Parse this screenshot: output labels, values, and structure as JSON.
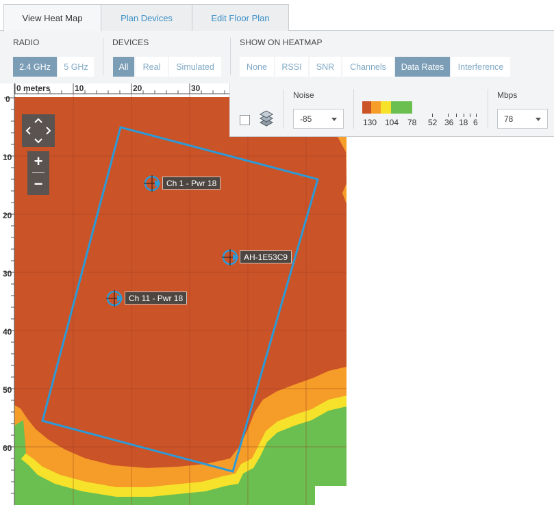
{
  "tabs": [
    {
      "label": "View Heat Map",
      "active": true
    },
    {
      "label": "Plan Devices",
      "active": false
    },
    {
      "label": "Edit Floor Plan",
      "active": false
    }
  ],
  "radio": {
    "title": "RADIO",
    "options": [
      "2.4 GHz",
      "5 GHz"
    ],
    "selected": "2.4 GHz"
  },
  "devices": {
    "title": "DEVICES",
    "options": [
      "All",
      "Real",
      "Simulated"
    ],
    "selected": "All"
  },
  "show_on_heatmap": {
    "title": "SHOW ON HEATMAP",
    "options": [
      "None",
      "RSSI",
      "SNR",
      "Channels",
      "Data Rates",
      "Interference"
    ],
    "selected": "Data Rates"
  },
  "legend": {
    "noise_label": "Noise",
    "noise_value": "-85",
    "mbps_label": "Mbps",
    "mbps_value": "78",
    "show_layers_checked": false,
    "scale_labels": [
      "130",
      "104",
      "78",
      "52",
      "36",
      "18",
      "6"
    ],
    "scale_colors": [
      "#cb5328",
      "#f59d28",
      "#f6e22a",
      "#6bbf50"
    ]
  },
  "rulers": {
    "x": [
      "0 meters",
      "10",
      "20",
      "30"
    ],
    "y": [
      "0",
      "10",
      "20",
      "30",
      "40",
      "50",
      "60"
    ]
  },
  "access_points": [
    {
      "label": "Ch 1 - Pwr 18"
    },
    {
      "label": "AH-1E53C9"
    },
    {
      "label": "Ch 11 - Pwr 18"
    }
  ],
  "colors": {
    "heat_high": "#cb5328",
    "heat_mid": "#f59d28",
    "heat_low": "#f6e22a",
    "heat_min": "#6bbf50",
    "floor_outline": "#2d9ad6",
    "accent_selected": "#7b9db6",
    "link_blue": "#3a8fc6"
  }
}
